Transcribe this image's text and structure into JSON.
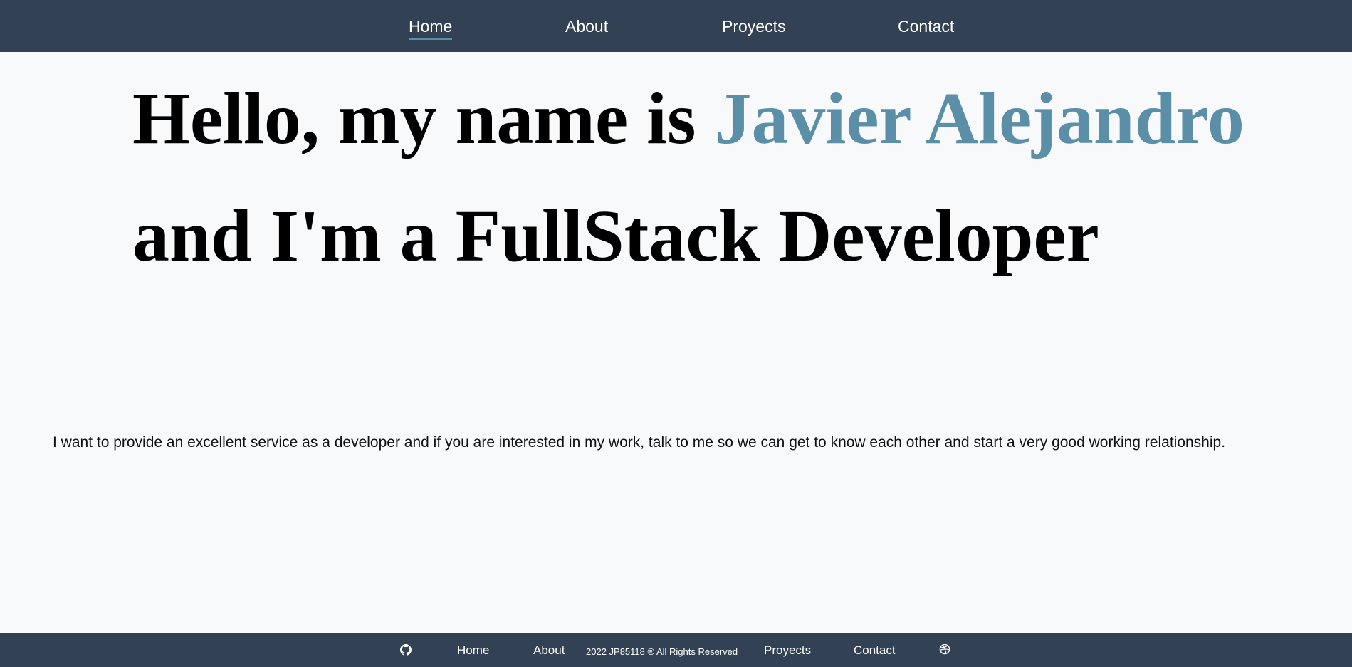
{
  "nav": {
    "items": [
      {
        "label": "Home",
        "active": true
      },
      {
        "label": "About"
      },
      {
        "label": "Proyects"
      },
      {
        "label": "Contact"
      }
    ]
  },
  "hero": {
    "prefix": "Hello, my name is ",
    "name": "Javier Alejandro",
    "suffix": " and I'm a FullStack Developer"
  },
  "intro": "I want to provide an excellent service as a developer and if you are interested in my work, talk to me so we can get to know each other and start a very good working relationship.",
  "footer": {
    "github_icon": "github-icon",
    "home": "Home",
    "about": "About",
    "copyright": "2022 JP85118 ® All Rights Reserved",
    "proyects": "Proyects",
    "contact": "Contact",
    "dribbble_icon": "dribbble-icon"
  },
  "colors": {
    "nav_background": "#334155",
    "accent": "#5b8fa8",
    "page_background": "#f7f9fb"
  }
}
